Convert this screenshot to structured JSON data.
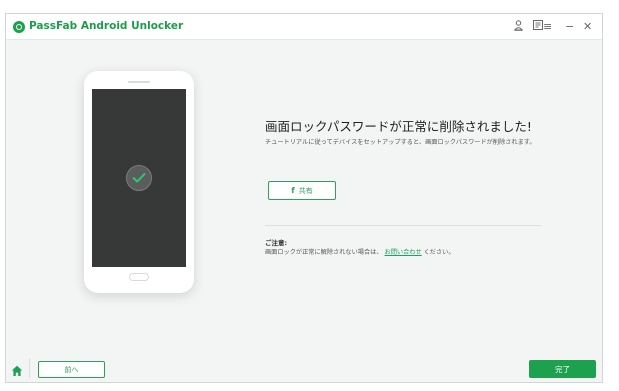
{
  "app": {
    "title": "PassFab Android Unlocker"
  },
  "titlebar": {
    "icons": [
      "user-icon",
      "feedback-icon",
      "menu-icon",
      "minimize-icon",
      "close-icon"
    ],
    "menu_glyph": "≡",
    "minimize_glyph": "−",
    "close_glyph": "✕"
  },
  "main": {
    "headline": "画面ロックパスワードが正常に削除されました!",
    "description": "チュートリアルに従ってデバイスをセットアップすると、画面ロックパスワードが削除されます。",
    "share_button": {
      "icon_glyph": "f",
      "label": "共有"
    },
    "note": {
      "title": "ご注意:",
      "text_before": "画面ロックが正常に解除されない場合は、",
      "link": "お問い合わせ",
      "text_after": "ください。"
    }
  },
  "footer": {
    "back_label": "前へ",
    "done_label": "完了"
  },
  "colors": {
    "accent": "#1ea14f",
    "phone_screen": "#373838",
    "background": "#f3f5f5"
  }
}
